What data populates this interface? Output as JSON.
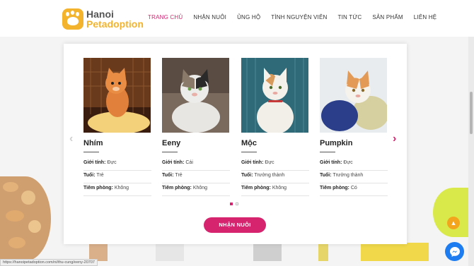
{
  "brand": {
    "line1": "Hanoi",
    "line2": "Petadoption"
  },
  "nav": [
    {
      "label": "TRANG CHỦ",
      "active": true
    },
    {
      "label": "NHẬN NUÔI",
      "active": false
    },
    {
      "label": "ỦNG HỘ",
      "active": false
    },
    {
      "label": "TÌNH NGUYỆN VIÊN",
      "active": false
    },
    {
      "label": "TIN TỨC",
      "active": false
    },
    {
      "label": "SẢN PHẨM",
      "active": false
    },
    {
      "label": "LIÊN HỆ",
      "active": false
    }
  ],
  "field_labels": {
    "gender": "Giới tính:",
    "age": "Tuổi:",
    "vaccine": "Tiêm phòng:"
  },
  "pets": [
    {
      "name": "Nhím",
      "gender": "Đực",
      "age": "Trẻ",
      "vaccine": "Không"
    },
    {
      "name": "Eeny",
      "gender": "Cái",
      "age": "Trẻ",
      "vaccine": "Không"
    },
    {
      "name": "Mộc",
      "gender": "Đực",
      "age": "Trưởng thành",
      "vaccine": "Không"
    },
    {
      "name": "Pumpkin",
      "gender": "Đực",
      "age": "Trưởng thành",
      "vaccine": "Có"
    }
  ],
  "carousel": {
    "pages": 2,
    "current": 1
  },
  "cta_label": "NHẬN NUÔI",
  "status_url": "https://hanoipetadoption.com/ni/thu-cung/eeny-20707",
  "icons": {
    "prev": "chevron-left-icon",
    "next": "chevron-right-icon",
    "to_top": "arrow-up-icon",
    "chat": "messenger-icon"
  },
  "colors": {
    "accent": "#d6246e",
    "brand": "#f3b32c",
    "chat": "#1c7cf0",
    "to_top": "#f3a61d"
  }
}
